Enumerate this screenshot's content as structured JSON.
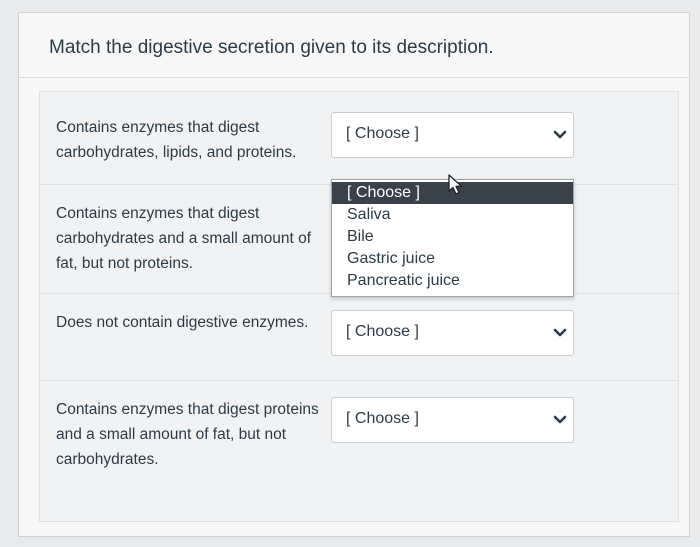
{
  "question": {
    "title": "Match the digestive secretion given to its description."
  },
  "rows": [
    {
      "description": "Contains enzymes that digest carbohydrates, lipids, and proteins.",
      "selected": "[ Choose ]",
      "dropdown_open": true
    },
    {
      "description": "Contains enzymes that digest carbohydrates and a small amount of fat, but not proteins.",
      "selected": "[ Choose ]",
      "dropdown_open": false
    },
    {
      "description": "Does not contain digestive enzymes.",
      "selected": "[ Choose ]",
      "dropdown_open": false
    },
    {
      "description": "Contains enzymes that digest proteins and a small amount of fat, but not carbohydrates.",
      "selected": "[ Choose ]",
      "dropdown_open": false
    }
  ],
  "dropdown_options": [
    "[ Choose ]",
    "Saliva",
    "Bile",
    "Gastric juice",
    "Pancreatic juice"
  ],
  "highlighted_option": "[ Choose ]",
  "icons": {
    "select_arrow": "chevron-down-icon",
    "cursor": "mouse-pointer-icon"
  },
  "colors": {
    "highlight_bg": "#39424a",
    "highlight_text": "#ffffff",
    "text": "#2d3b45",
    "border": "#c7cdd1"
  }
}
